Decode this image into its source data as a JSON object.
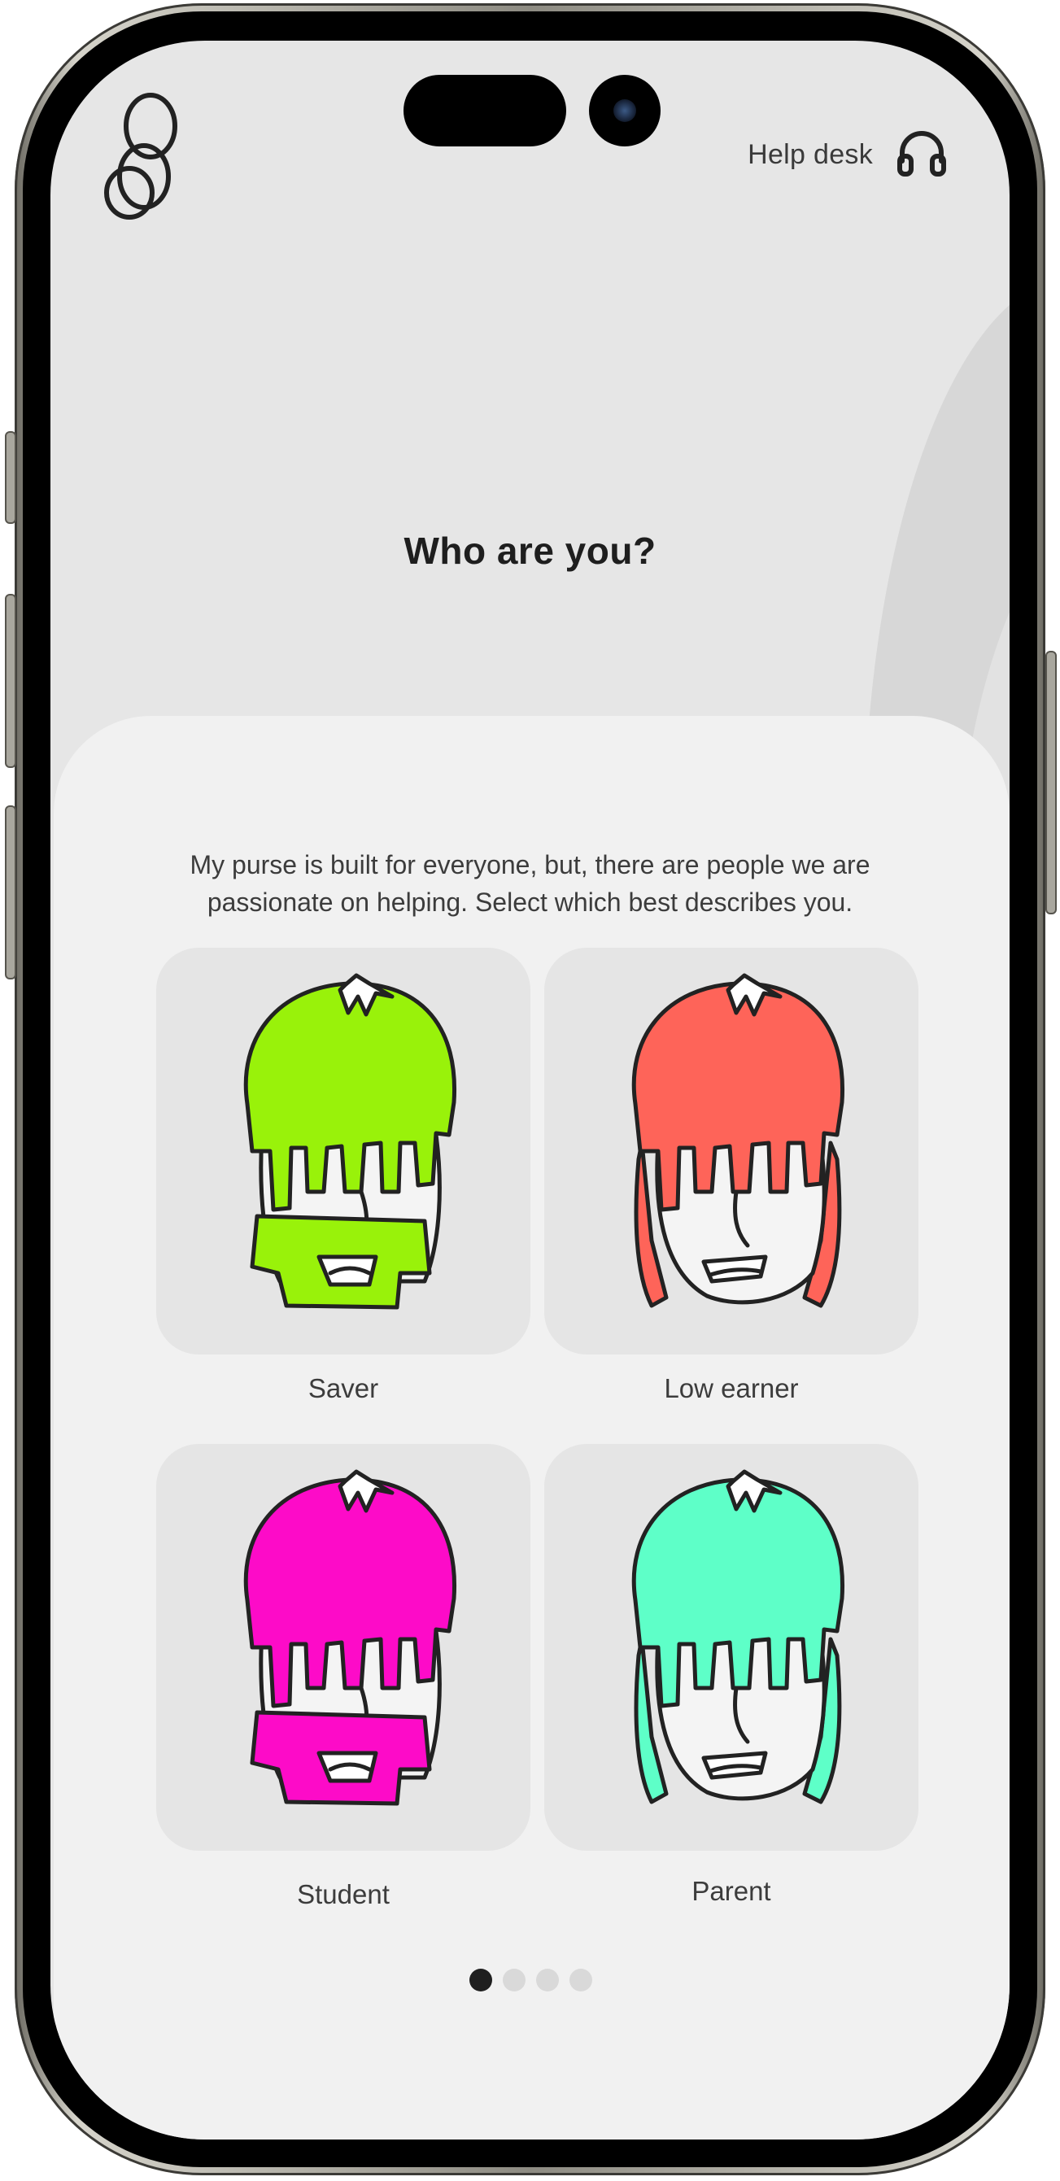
{
  "header": {
    "logo_icon": "interlocking-rings-logo",
    "help_label": "Help desk",
    "help_icon": "headphones-icon"
  },
  "page": {
    "title": "Who are you?",
    "description": "My purse is built for everyone, but, there are people we are\npassionate on helping. Select which best describes you."
  },
  "personas": [
    {
      "label": "Saver",
      "color": "#99f20a",
      "style": "mask"
    },
    {
      "label": "Low earner",
      "color": "#fe6459",
      "style": "long-hair"
    },
    {
      "label": "Student",
      "color": "#fd0bc8",
      "style": "mask"
    },
    {
      "label": "Parent",
      "color": "#5effc8",
      "style": "long-hair"
    }
  ],
  "pagination": {
    "total": 4,
    "current": 1
  }
}
